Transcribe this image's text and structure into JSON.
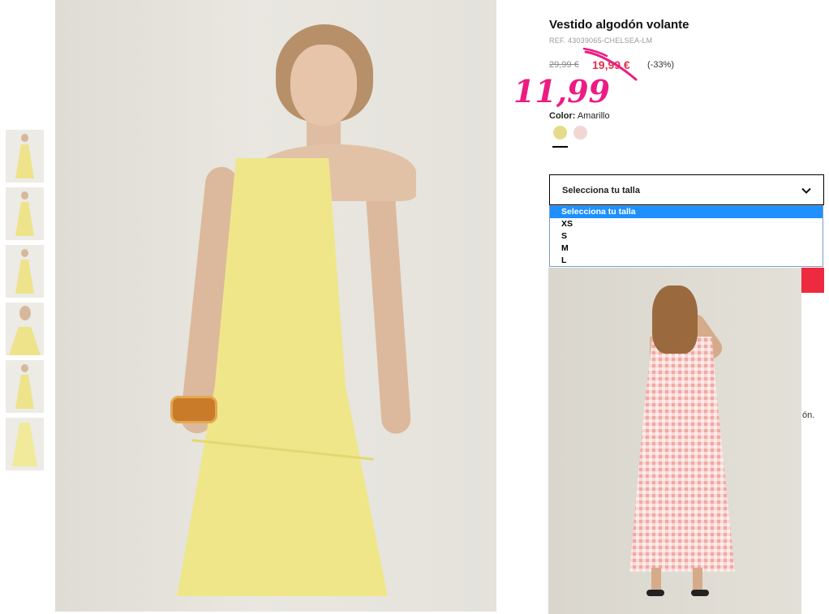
{
  "product": {
    "title": "Vestido algodón volante",
    "ref": "REF. 43039065-CHELSEA-LM",
    "price_old": "29,99 €",
    "price_sale": "19,99 €",
    "discount": "(-33%)",
    "handwritten_price": "11,99"
  },
  "color": {
    "label": "Color:",
    "value": "Amarillo",
    "swatches": [
      {
        "name": "Amarillo",
        "hex": "#e4dc8a",
        "selected": true
      },
      {
        "name": "Rosa",
        "hex": "#f3d6d3",
        "selected": false
      }
    ]
  },
  "size_select": {
    "current": "Selecciona tu talla",
    "options": [
      "Selecciona tu talla",
      "XS",
      "S",
      "M",
      "L"
    ],
    "highlighted_index": 0
  },
  "colors": {
    "sale_red": "#e2304a",
    "handwritten_pink": "#ec1b83",
    "accent_red": "#ee2a3e",
    "dropdown_highlight": "#1e90ff"
  },
  "partial_text": "ón.",
  "icons": {
    "dropdown": "chevron-down-icon"
  }
}
